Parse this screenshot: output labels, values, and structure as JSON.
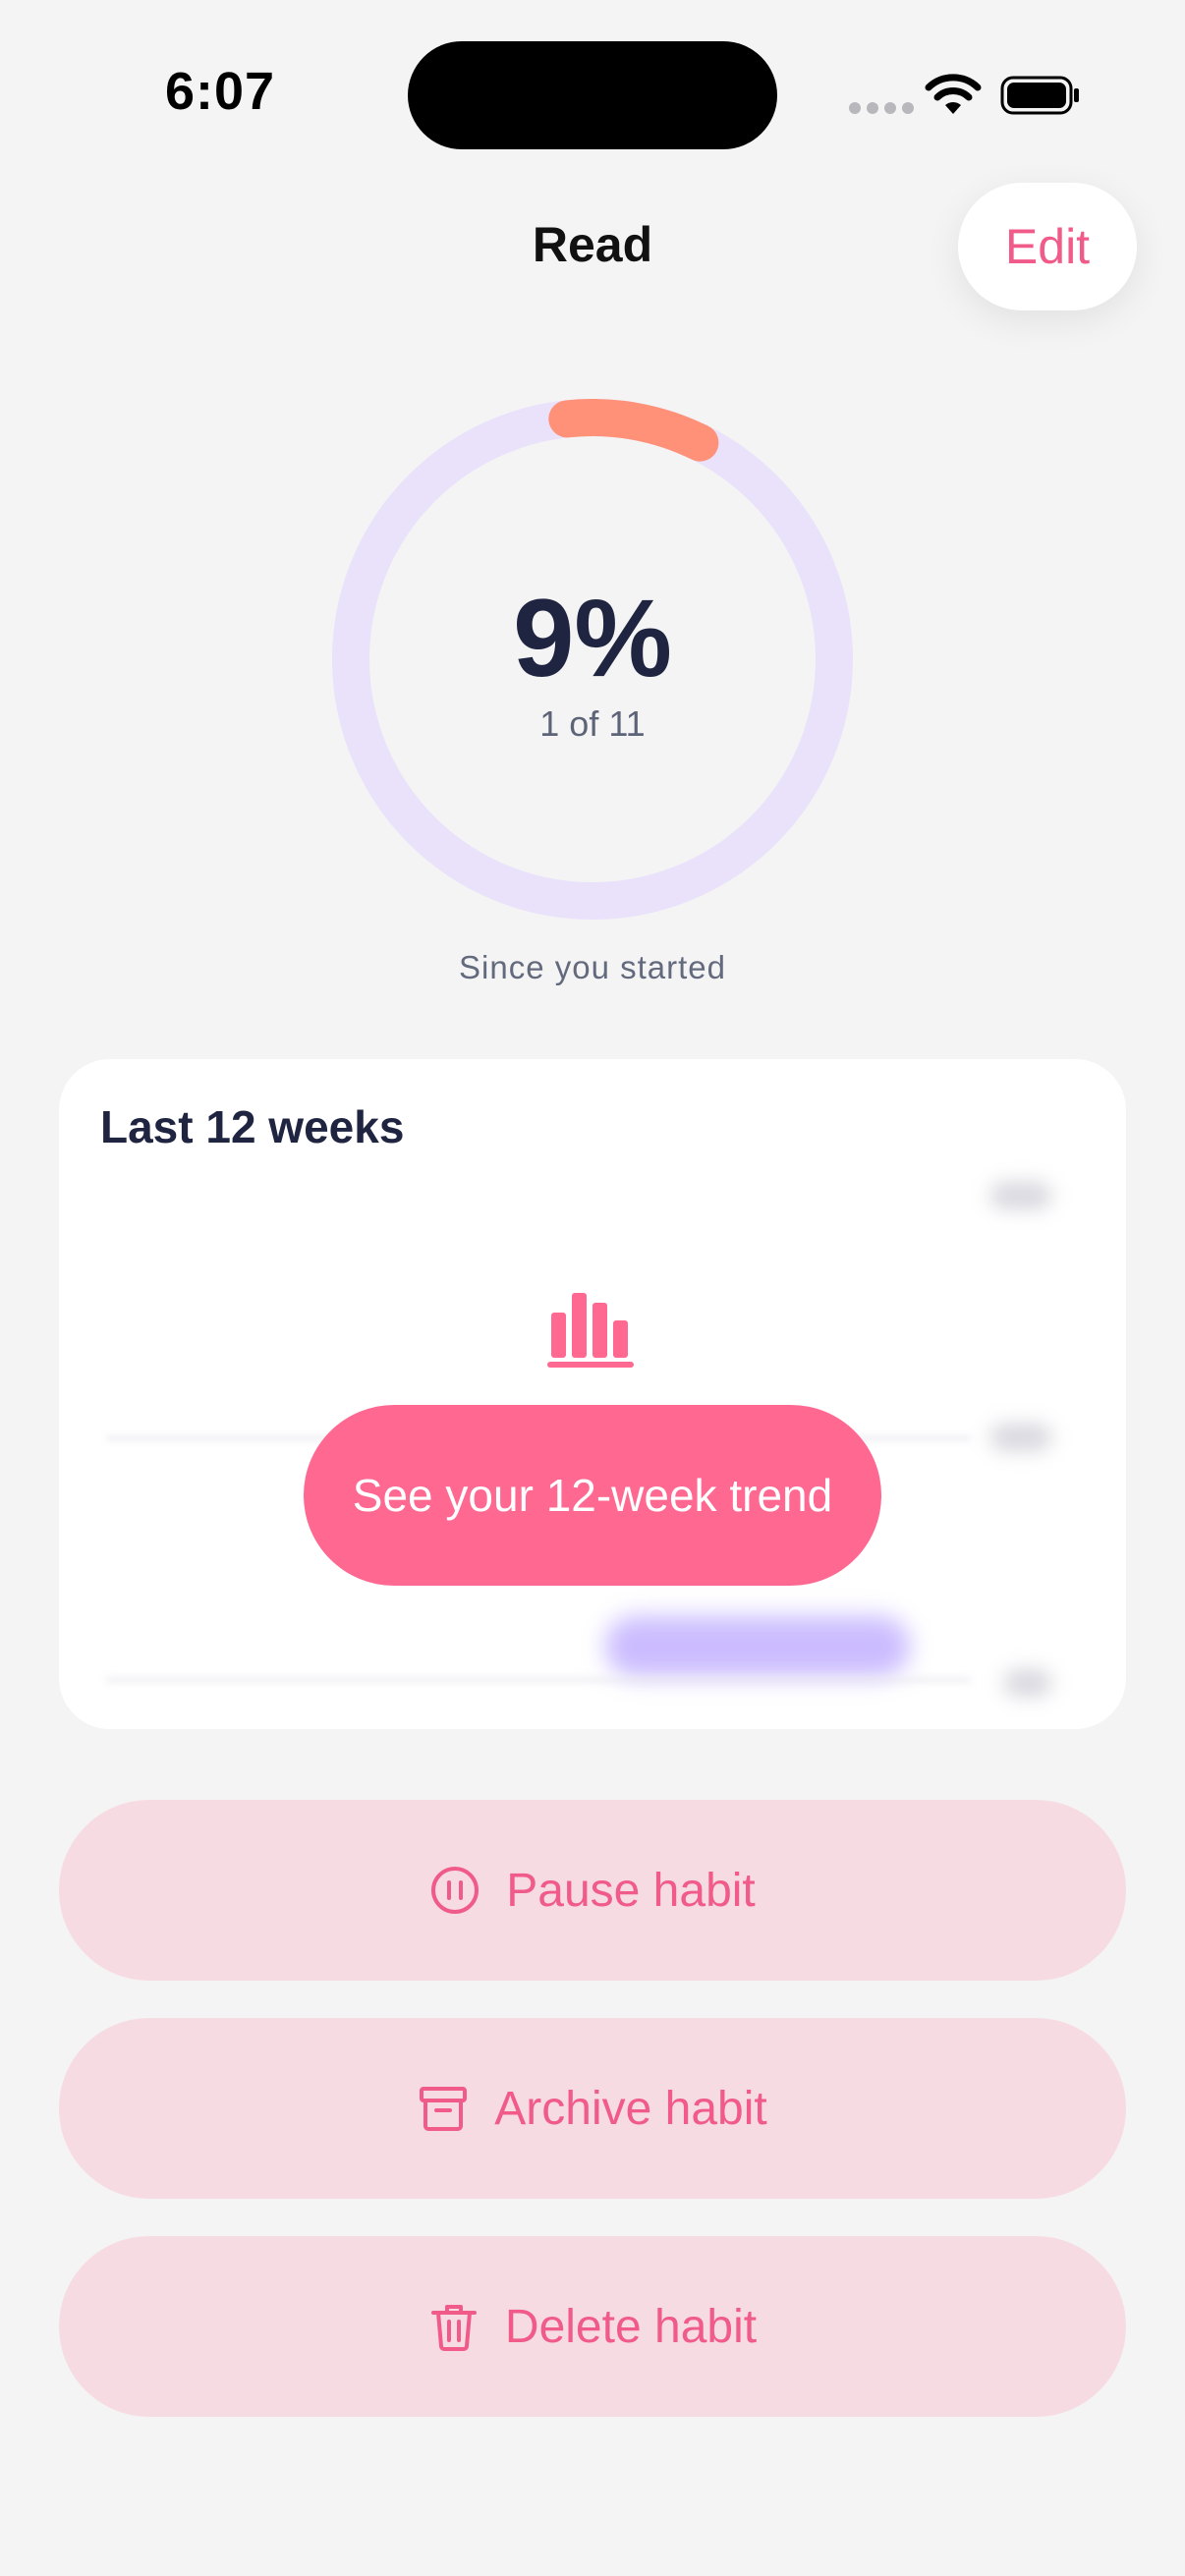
{
  "status_bar": {
    "time": "6:07"
  },
  "header": {
    "title": "Read",
    "edit_label": "Edit"
  },
  "progress": {
    "percent_label": "9%",
    "count_label": "1 of 11",
    "fraction": 0.09,
    "caption": "Since you started",
    "track_color": "#e9e2fa",
    "fill_color": "#ff9178"
  },
  "weeks_card": {
    "title": "Last 12 weeks",
    "cta_label": "See your 12-week trend",
    "icon": "bar-chart-icon",
    "accent": "#ff6891"
  },
  "actions": {
    "pause": {
      "label": "Pause habit",
      "icon": "pause-circle-icon"
    },
    "archive": {
      "label": "Archive habit",
      "icon": "archive-box-icon"
    },
    "delete": {
      "label": "Delete habit",
      "icon": "trash-icon"
    }
  },
  "colors": {
    "background": "#f4f4f5",
    "accent": "#f05b8a",
    "action_bg": "#f7dbe2"
  }
}
